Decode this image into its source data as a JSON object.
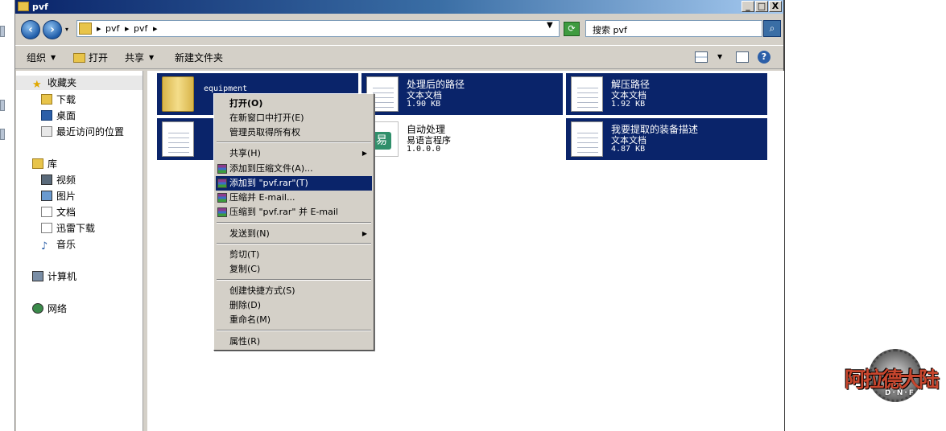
{
  "window": {
    "title": "pvf"
  },
  "titlebar_buttons": {
    "minimize": "_",
    "maximize": "□",
    "close": "X"
  },
  "address": {
    "crumbs": [
      "▸",
      "pvf",
      "▸",
      "pvf",
      "▸"
    ],
    "search_placeholder": "搜索 pvf"
  },
  "toolbar": {
    "organize": "组织",
    "open": "打开",
    "share": "共享",
    "new_folder": "新建文件夹"
  },
  "nav": {
    "favorites": "收藏夹",
    "downloads": "下载",
    "desktop": "桌面",
    "recent": "最近访问的位置",
    "libraries": "库",
    "videos": "视频",
    "pictures": "图片",
    "documents": "文档",
    "thunder": "迅雷下载",
    "music": "音乐",
    "computer": "计算机",
    "network": "网络"
  },
  "files": [
    {
      "name": "equipment",
      "type": "",
      "size": ""
    },
    {
      "name": "处理后的路径",
      "type": "文本文档",
      "size": "1.90 KB"
    },
    {
      "name": "解压路径",
      "type": "文本文档",
      "size": "1.92 KB"
    },
    {
      "name": "",
      "type": "",
      "size": ""
    },
    {
      "name": "自动处理",
      "type": "易语言程序",
      "size": "1.0.0.0"
    },
    {
      "name": "我要提取的装备描述",
      "type": "文本文档",
      "size": "4.87 KB"
    }
  ],
  "context_menu": {
    "open": "打开(O)",
    "open_new": "在新窗口中打开(E)",
    "admin": "管理员取得所有权",
    "share": "共享(H)",
    "add_archive": "添加到压缩文件(A)...",
    "add_pvf": "添加到 \"pvf.rar\"(T)",
    "compress_email": "压缩并 E-mail...",
    "compress_pvf_email": "压缩到 \"pvf.rar\" 并 E-mail",
    "send_to": "发送到(N)",
    "cut": "剪切(T)",
    "copy": "复制(C)",
    "shortcut": "创建快捷方式(S)",
    "delete": "删除(D)",
    "rename": "重命名(M)",
    "properties": "属性(R)"
  },
  "logo": {
    "title": "阿拉德大陆",
    "sub": "D·N·F"
  },
  "colors": {
    "selection": "#0a246a",
    "chrome": "#d4d0c8"
  }
}
